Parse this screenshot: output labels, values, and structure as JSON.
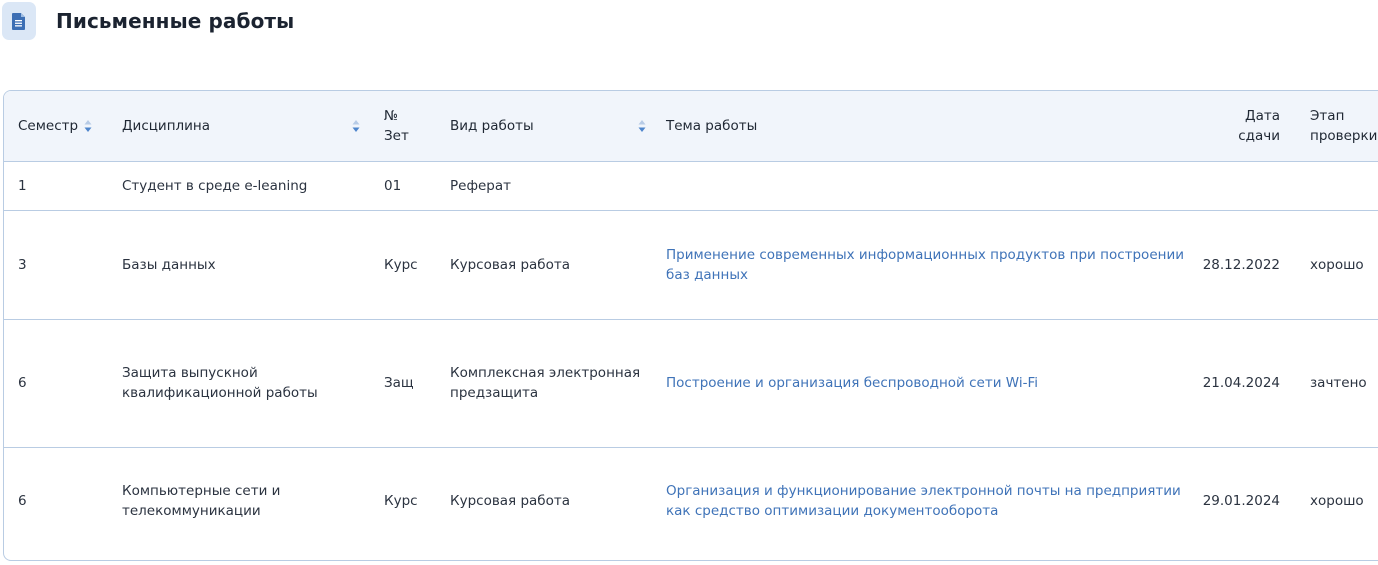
{
  "page": {
    "title": "Письменные работы",
    "icon": "document-icon"
  },
  "table": {
    "headers": {
      "semester": "Семестр",
      "discipline": "Дисциплина",
      "zet_line1": "№",
      "zet_line2": "Зет",
      "work_type": "Вид работы",
      "topic": "Тема работы",
      "date_line1": "Дата",
      "date_line2": "сдачи",
      "stage_line1": "Этап",
      "stage_line2": "проверки"
    },
    "rows": [
      {
        "semester": "1",
        "discipline": "Студент в среде e-leaning",
        "zet": "01",
        "work_type": "Реферат",
        "topic": "",
        "date": "",
        "stage": ""
      },
      {
        "semester": "3",
        "discipline": "Базы данных",
        "zet": "Курс",
        "work_type": "Курсовая работа",
        "topic": "Применение современных информационных продуктов при построении баз данных",
        "date": "28.12.2022",
        "stage": "хорошо"
      },
      {
        "semester": "6",
        "discipline": "Защита выпускной квалификационной работы",
        "zet": "Защ",
        "work_type": "Комплексная электронная предзащита",
        "topic": "Построение и организация беспроводной сети Wi-Fi",
        "date": "21.04.2024",
        "stage": "зачтено"
      },
      {
        "semester": "6",
        "discipline": "Компьютерные сети и телекоммуникации",
        "zet": "Курс",
        "work_type": "Курсовая работа",
        "topic": "Организация и функционирование электронной почты на предприятии как средство оптимизации документооборота",
        "date": "29.01.2024",
        "stage": "хорошо"
      }
    ]
  },
  "colors": {
    "accent": "#3f73b8",
    "header_bg": "#f1f5fb",
    "border": "#b9cce3",
    "badge_bg": "#dbe7f6",
    "sort_up": "#b7cbe6",
    "sort_down": "#4f86cc"
  }
}
